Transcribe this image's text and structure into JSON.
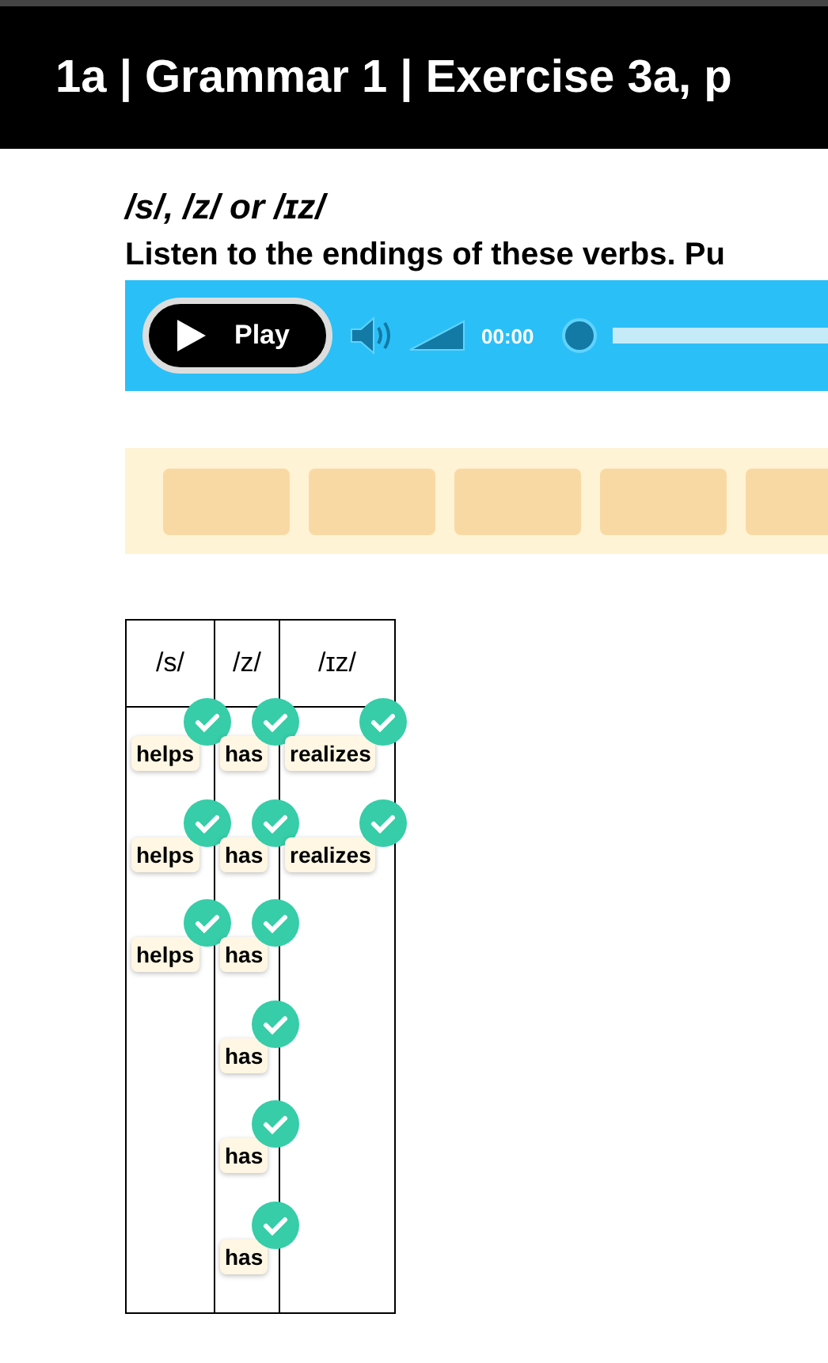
{
  "header": {
    "title": "1a | Grammar 1 | Exercise 3a, p"
  },
  "heading": "/s/, /z/ or /ɪz/",
  "instruction": "Listen to the endings of these verbs. Pu",
  "player": {
    "play_label": "Play",
    "time": "00:00"
  },
  "table": {
    "columns": [
      {
        "heading": "/s/",
        "answers": [
          {
            "text": "helps",
            "correct": true
          },
          {
            "text": "helps",
            "correct": true
          },
          {
            "text": "helps",
            "correct": true
          }
        ]
      },
      {
        "heading": "/z/",
        "answers": [
          {
            "text": "has",
            "correct": true
          },
          {
            "text": "has",
            "correct": true
          },
          {
            "text": "has",
            "correct": true
          },
          {
            "text": "has",
            "correct": true
          },
          {
            "text": "has",
            "correct": true
          },
          {
            "text": "has",
            "correct": true
          }
        ]
      },
      {
        "heading": "/ɪz/",
        "answers": [
          {
            "text": "realizes",
            "correct": true
          },
          {
            "text": "realizes",
            "correct": true
          }
        ]
      }
    ]
  }
}
